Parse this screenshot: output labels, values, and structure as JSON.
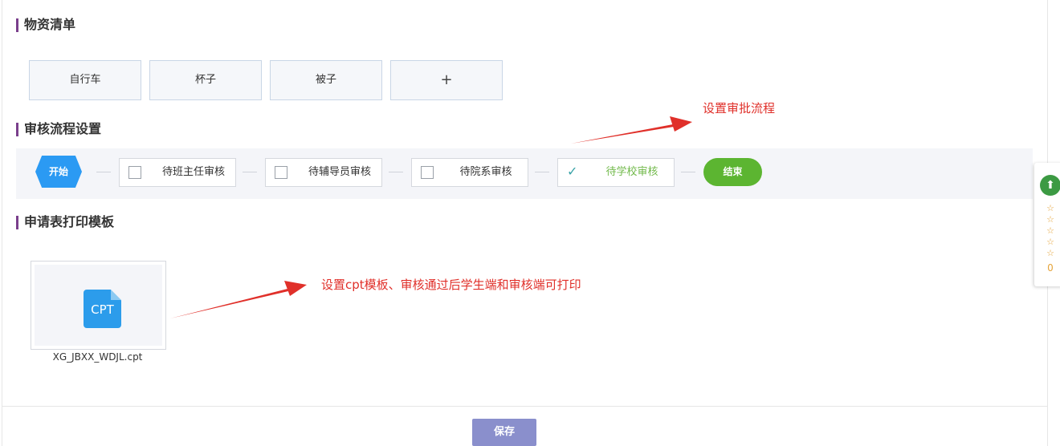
{
  "sections": {
    "materials": {
      "title": "物资清单",
      "items": [
        "自行车",
        "杯子",
        "被子"
      ],
      "add_label": "+"
    },
    "approval": {
      "title": "审核流程设置",
      "start_label": "开始",
      "steps": [
        {
          "label": "待班主任审核",
          "checked": false
        },
        {
          "label": "待辅导员审核",
          "checked": false
        },
        {
          "label": "待院系审核",
          "checked": false
        },
        {
          "label": "待学校审核",
          "checked": true
        }
      ],
      "end_label": "结束"
    },
    "print_template": {
      "title": "申请表打印模板",
      "file_icon_text": "CPT",
      "file_name": "XG_JBXX_WDJL.cpt"
    }
  },
  "annotations": {
    "approval_note": "设置审批流程",
    "template_note": "设置cpt模板、审核通过后学生端和审核端可打印"
  },
  "footer": {
    "save_label": "保存"
  },
  "side_widget": {
    "up_icon": "arrow-up-icon",
    "star_icon": "star-outline-icon",
    "rating_count": "0"
  },
  "colors": {
    "section_marker": "#7a3f8c",
    "start_node": "#2b9af3",
    "end_node": "#5cb531",
    "save_button": "#8a8fcc",
    "annotation": "#e0302a",
    "checked_step": "#71b94a"
  }
}
